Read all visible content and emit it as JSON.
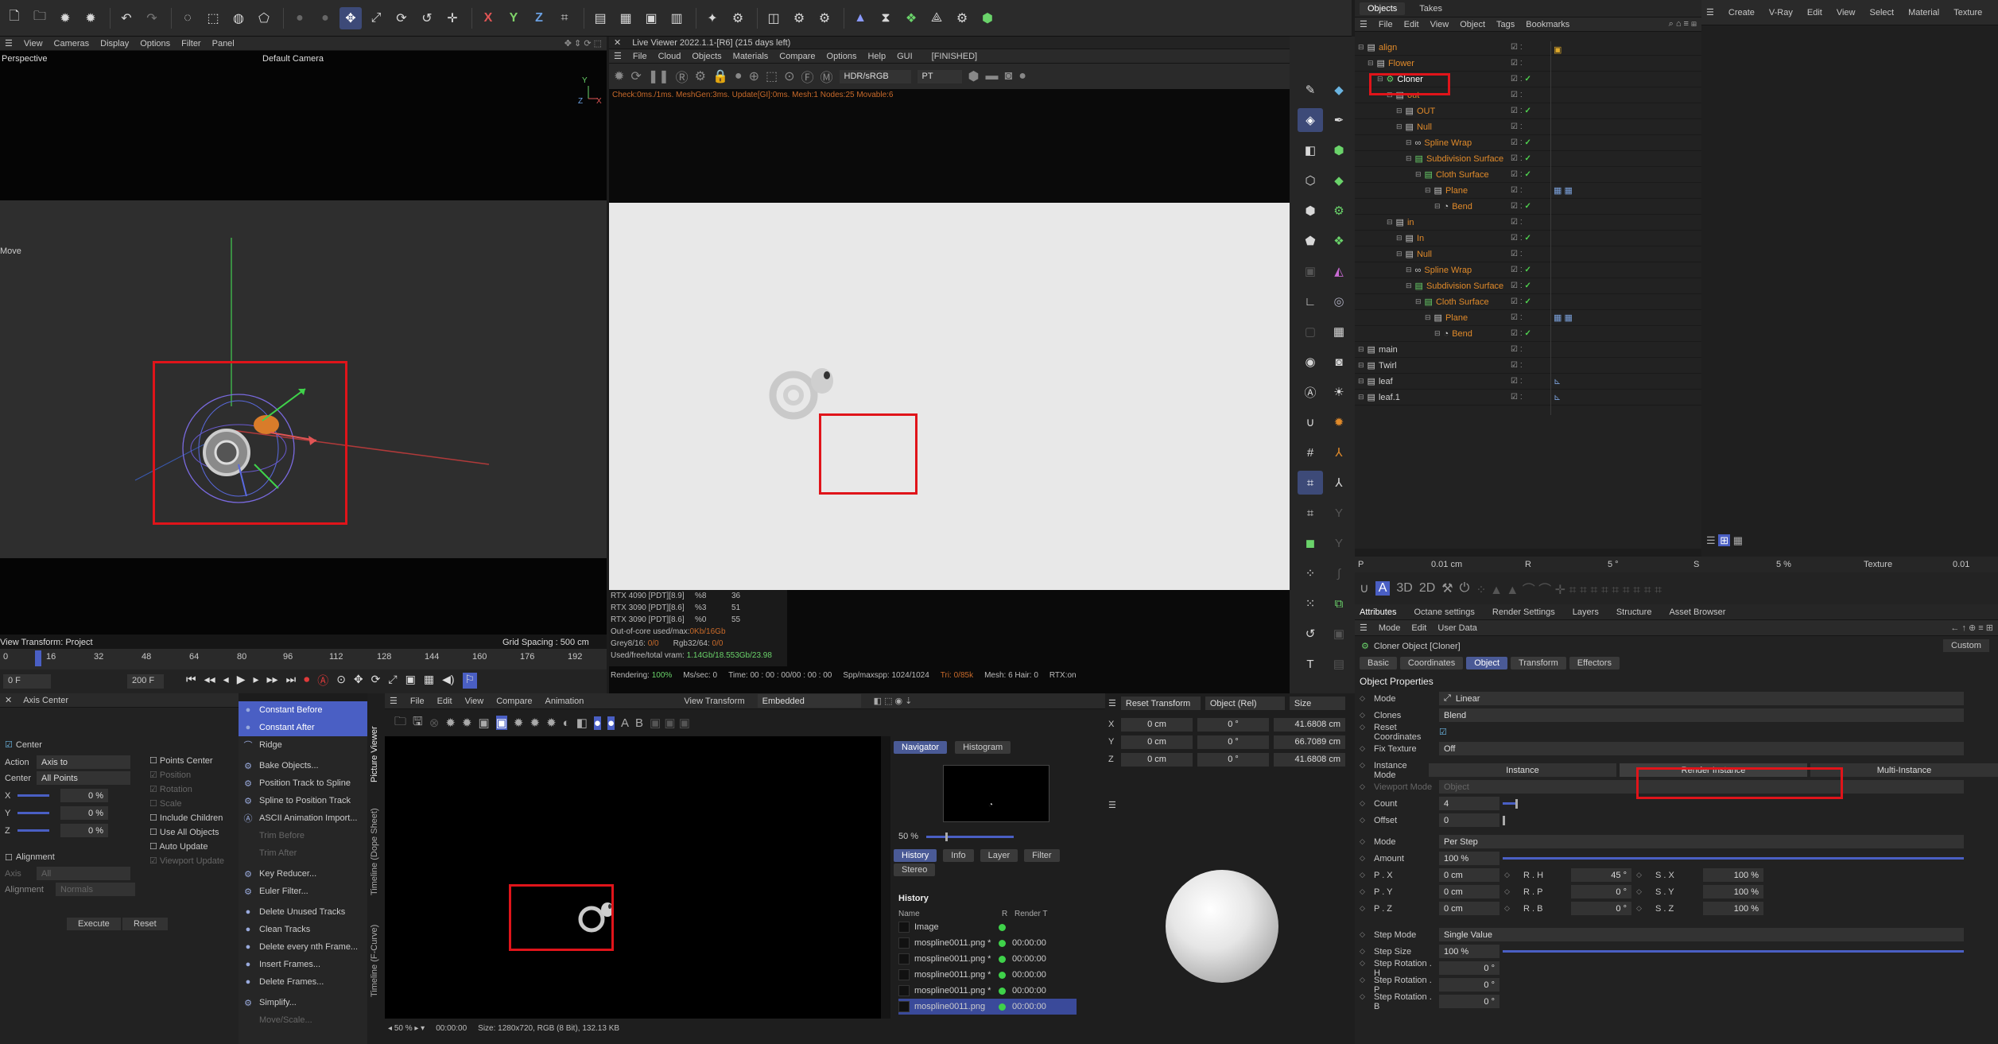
{
  "toolbar": {
    "icons": [
      "new-file-icon",
      "open-folder-icon",
      "render-settings-icon",
      "render-icon",
      "undo-icon",
      "redo-icon",
      "live-selection-icon",
      "rect-selection-icon",
      "lasso-icon",
      "poly-selection-icon",
      "sphere-icon",
      "move-icon",
      "scale-icon",
      "rotate-icon",
      "recent-tool-icon",
      "transform-icon",
      "x-axis-icon",
      "y-axis-icon",
      "z-axis-icon",
      "coordinate-icon",
      "render-view-icon",
      "clapper-icon",
      "render-picture-icon",
      "render-queue-icon",
      "effects-icon",
      "settings-gear-icon",
      "cube-icon",
      "subdivision-icon",
      "deform-icon",
      "tri-mesh-icon",
      "fracture-icon",
      "gear-icon",
      "vray-icon"
    ],
    "axis_labels": [
      "X",
      "Y",
      "Z"
    ]
  },
  "viewport": {
    "menu": [
      "View",
      "Cameras",
      "Display",
      "Options",
      "Filter",
      "Panel"
    ],
    "label": "Perspective",
    "camera": "Default Camera",
    "move_label": "Move",
    "view_transform": "View Transform: Project",
    "grid_spacing": "Grid Spacing : 500 cm",
    "axis_x": "X",
    "axis_y": "Y",
    "axis_z": "Z"
  },
  "timeline": {
    "ticks": [
      "0",
      "16",
      "32",
      "48",
      "64",
      "80",
      "96",
      "112",
      "128",
      "144",
      "160",
      "176",
      "192"
    ],
    "current": "0 F",
    "end": "200 F",
    "frame_marker": "0"
  },
  "live_viewer": {
    "title": "Live Viewer 2022.1.1-[R6] (215 days left)",
    "menu": [
      "File",
      "Cloud",
      "Objects",
      "Materials",
      "Compare",
      "Options",
      "Help",
      "GUI"
    ],
    "status": "[FINISHED]",
    "color_space": "HDR/sRGB",
    "mode": "PT",
    "check_line": "Check:0ms./1ms. MeshGen:3ms. Update[GI]:0ms. Mesh:1 Nodes:25 Movable:6",
    "gpu_rows": [
      [
        "RTX 4090 [PDT][8.9]",
        "%8",
        "36"
      ],
      [
        "RTX 3090 [PDT][8.6]",
        "%3",
        "51"
      ],
      [
        "RTX 3090 [PDT][8.6]",
        "%0",
        "55"
      ]
    ],
    "ooc": "Out-of-core used/max:",
    "ooc_val": "0Kb/16Gb",
    "grey": "Grey8/16: ",
    "grey_val": "0/0",
    "rgb": "Rgb32/64: ",
    "rgb_val": "0/0",
    "vram": "Used/free/total vram: ",
    "vram_val": "1.14Gb/18.553Gb/23.98",
    "render_status": "Rendering: ",
    "render_pct": "100%",
    "ms": "Ms/sec: 0",
    "time": "Time: 00 : 00 : 00/00 : 00 : 00",
    "spp": "Spp/maxspp: 1024/1024",
    "tri": "Tri: 0/85k",
    "meshinfo": "Mesh: 6 Hair: 0",
    "rtx": "RTX:on"
  },
  "objects": {
    "tabs": [
      "Objects",
      "Takes"
    ],
    "menu": [
      "File",
      "Edit",
      "View",
      "Object",
      "Tags",
      "Bookmarks"
    ],
    "rows": [
      {
        "name": "align",
        "indent": 0
      },
      {
        "name": "Flower",
        "indent": 1
      },
      {
        "name": "Cloner",
        "indent": 2
      },
      {
        "name": "out",
        "indent": 3
      },
      {
        "name": "OUT",
        "indent": 4
      },
      {
        "name": "Null",
        "indent": 4
      },
      {
        "name": "Spline Wrap",
        "indent": 5
      },
      {
        "name": "Subdivision Surface",
        "indent": 5
      },
      {
        "name": "Cloth Surface",
        "indent": 6
      },
      {
        "name": "Plane",
        "indent": 7
      },
      {
        "name": "Bend",
        "indent": 8
      },
      {
        "name": "in",
        "indent": 3
      },
      {
        "name": "In",
        "indent": 4
      },
      {
        "name": "Null",
        "indent": 4
      },
      {
        "name": "Spline Wrap",
        "indent": 5
      },
      {
        "name": "Subdivision Surface",
        "indent": 5
      },
      {
        "name": "Cloth Surface",
        "indent": 6
      },
      {
        "name": "Plane",
        "indent": 7
      },
      {
        "name": "Bend",
        "indent": 8
      },
      {
        "name": "main",
        "indent": 0
      },
      {
        "name": "Twirl",
        "indent": 0
      },
      {
        "name": "leaf",
        "indent": 0
      },
      {
        "name": "leaf.1",
        "indent": 0
      }
    ]
  },
  "right_menu": {
    "items": [
      "Create",
      "V-Ray",
      "Edit",
      "View",
      "Select",
      "Material",
      "Texture"
    ]
  },
  "coord_strip": {
    "p_label": "P",
    "p_val": "0.01 cm",
    "r_label": "R",
    "r_val": "5 °",
    "s_label": "S",
    "s_val": "5 %",
    "tex_label": "Texture",
    "tex_val": "0.01"
  },
  "attributes": {
    "tabs": [
      "Attributes",
      "Octane settings",
      "Render Settings",
      "Layers",
      "Structure",
      "Asset Browser"
    ],
    "menu": [
      "Mode",
      "Edit",
      "User Data"
    ],
    "title": "Cloner Object [Cloner]",
    "custom": "Custom",
    "subtabs": [
      "Basic",
      "Coordinates",
      "Object",
      "Transform",
      "Effectors"
    ],
    "section": "Object Properties",
    "mode_label": "Mode",
    "mode_val": "Linear",
    "clones_label": "Clones",
    "clones_val": "Blend",
    "reset_label": "Reset Coordinates",
    "fix_label": "Fix Texture",
    "fix_val": "Off",
    "instance_label": "Instance Mode",
    "inst_opts": [
      "Instance",
      "Render Instance",
      "Multi-Instance"
    ],
    "viewport_label": "Viewport Mode",
    "viewport_val": "Object",
    "count_label": "Count",
    "count_val": "4",
    "offset_label": "Offset",
    "offset_val": "0",
    "mode2_label": "Mode",
    "mode2_val": "Per Step",
    "amount_label": "Amount",
    "amount_val": "100 %",
    "px_label": "P . X",
    "px": "0 cm",
    "py_label": "P . Y",
    "py": "0 cm",
    "pz_label": "P . Z",
    "pz": "0 cm",
    "rh_label": "R . H",
    "rh": "45 °",
    "rp_label": "R . P",
    "rp": "0 °",
    "rb_label": "R . B",
    "rb": "0 °",
    "sx_label": "S . X",
    "sx": "100 %",
    "sy_label": "S . Y",
    "sy": "100 %",
    "sz_label": "S . Z",
    "sz": "100 %",
    "stepmode_label": "Step Mode",
    "stepmode_val": "Single Value",
    "stepsize_label": "Step Size",
    "stepsize_val": "100 %",
    "srh_label": "Step Rotation . H",
    "srh": "0 °",
    "srp_label": "Step Rotation . P",
    "srp": "0 °",
    "srb_label": "Step Rotation . B",
    "srb": "0 °"
  },
  "axis_center": {
    "title": "Axis Center",
    "center_label": "Center",
    "action_label": "Action",
    "action_val": "Axis to",
    "center2_label": "Center",
    "center2_val": "All Points",
    "x": "X",
    "y": "Y",
    "z": "Z",
    "xv": "0 %",
    "yv": "0 %",
    "zv": "0 %",
    "alignment": "Alignment",
    "axis_label": "Axis",
    "axis_val": "All",
    "align2_label": "Alignment",
    "align2_val": "Normals",
    "points_center": "Points Center",
    "position": "Position",
    "rotation": "Rotation",
    "scale": "Scale",
    "include_children": "Include Children",
    "use_all": "Use All Objects",
    "auto_update": "Auto Update",
    "viewport_update": "Viewport Update",
    "execute": "Execute",
    "reset": "Reset"
  },
  "context_menu": {
    "items": [
      {
        "label": "Constant Before",
        "on": true,
        "dis": false
      },
      {
        "label": "Constant After",
        "on": true,
        "dis": false
      },
      {
        "label": "Ridge",
        "on": false,
        "dis": false
      },
      {
        "label": "Bake Objects...",
        "on": false,
        "dis": false
      },
      {
        "label": "Position Track to Spline",
        "on": false,
        "dis": false
      },
      {
        "label": "Spline to Position Track",
        "on": false,
        "dis": false
      },
      {
        "label": "ASCII Animation Import...",
        "on": false,
        "dis": false
      },
      {
        "label": "Trim Before",
        "on": false,
        "dis": true
      },
      {
        "label": "Trim After",
        "on": false,
        "dis": true
      },
      {
        "label": "Key Reducer...",
        "on": false,
        "dis": false
      },
      {
        "label": "Euler Filter...",
        "on": false,
        "dis": false
      },
      {
        "label": "Delete Unused Tracks",
        "on": false,
        "dis": false
      },
      {
        "label": "Clean Tracks",
        "on": false,
        "dis": false
      },
      {
        "label": "Delete every nth Frame...",
        "on": false,
        "dis": false
      },
      {
        "label": "Insert Frames...",
        "on": false,
        "dis": false
      },
      {
        "label": "Delete Frames...",
        "on": false,
        "dis": false
      },
      {
        "label": "Simplify...",
        "on": false,
        "dis": false
      },
      {
        "label": "Move/Scale...",
        "on": false,
        "dis": true
      }
    ],
    "side_tabs": [
      "Picture Viewer",
      "Timeline (Dope Sheet)",
      "Timeline (F-Curve)"
    ]
  },
  "picture_viewer": {
    "menu": [
      "File",
      "Edit",
      "View",
      "Compare",
      "Animation"
    ],
    "view_transform": "View Transform",
    "view_val": "Embedded",
    "zoom": "50 %",
    "time": "00:00:00",
    "size": "Size: 1280x720, RGB (8 Bit), 132.13 KB",
    "ab": [
      "A",
      "B"
    ],
    "nav_tabs": [
      "Navigator",
      "Histogram"
    ],
    "nav_zoom": "50 %",
    "hist_tabs": [
      "History",
      "Info",
      "Layer",
      "Filter"
    ],
    "stereo": "Stereo",
    "history_title": "History",
    "col_name": "Name",
    "col_r": "R",
    "col_rt": "Render T",
    "rows": [
      {
        "name": "Image",
        "time": ""
      },
      {
        "name": "mospline0011.png *",
        "time": "00:00:00"
      },
      {
        "name": "mospline0011.png *",
        "time": "00:00:00"
      },
      {
        "name": "mospline0011.png *",
        "time": "00:00:00"
      },
      {
        "name": "mospline0011.png *",
        "time": "00:00:00"
      },
      {
        "name": "mospline0011.png",
        "time": "00:00:00"
      }
    ]
  },
  "transform_panel": {
    "reset": "Reset Transform",
    "obj_rel": "Object (Rel)",
    "size": "Size",
    "rows": [
      {
        "axis": "X",
        "pos": "0 cm",
        "rot": "0 °",
        "size": "41.6808 cm"
      },
      {
        "axis": "Y",
        "pos": "0 cm",
        "rot": "0 °",
        "size": "66.7089 cm"
      },
      {
        "axis": "Z",
        "pos": "0 cm",
        "rot": "0 °",
        "size": "41.6808 cm"
      }
    ]
  },
  "colors": {
    "accent": "#4a5fc4",
    "highlight": "#e0141a",
    "object_orange": "#e08a2a",
    "check_green": "#4fd24f"
  }
}
